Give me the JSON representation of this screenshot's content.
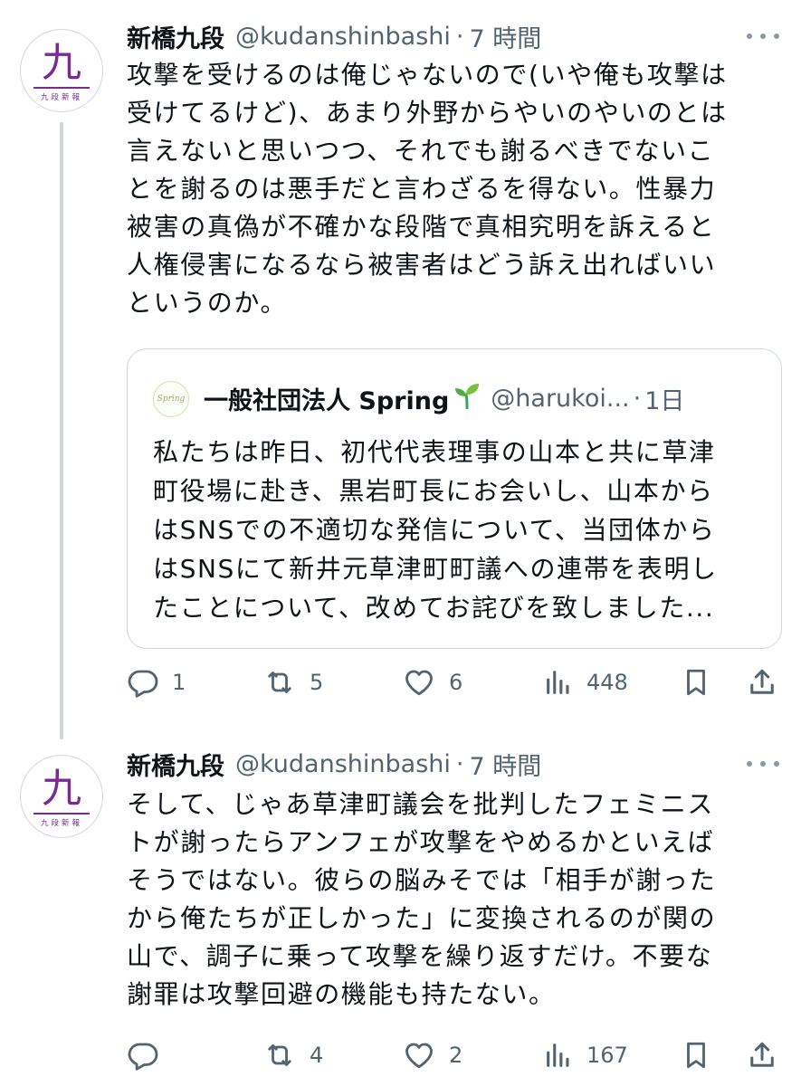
{
  "tweets": [
    {
      "author": "新橋九段",
      "handle": "@kudanshinbashi",
      "separator": "·",
      "time": "7 時間",
      "avatar": {
        "kanji": "九",
        "subtitle": "九段新報",
        "icon": "kudan-shinpo-logo"
      },
      "text": "攻撃を受けるのは俺じゃないので(いや俺も攻撃は\n受けてるけど)、あまり外野からやいのやいのとは\n言えないと思いつつ、それでも謝るべきでないこ\nとを謝るのは悪手だと言わざるを得ない。性暴力\n被害の真偽が不確かな段階で真相究明を訴えると\n人権侵害になるなら被害者はどう訴え出ればいい\nというのか。",
      "quote": {
        "author": "一般社団法人 Spring",
        "author_emoji": "seedling-icon",
        "handle": "@harukoi...",
        "separator": "·",
        "time": "1日",
        "avatar_text": "Spring",
        "text": "私たちは昨日、初代代表理事の山本と共に草津\n町役場に赴き、黒岩町長にお会いし、山本から\nはSNSでの不適切な発信について、当団体から\nはSNSにて新井元草津町町議への連帯を表明し\nたことについて、改めてお詫びを致しました..."
      },
      "stats": {
        "replies": "1",
        "reposts": "5",
        "likes": "6",
        "views": "448"
      }
    },
    {
      "author": "新橋九段",
      "handle": "@kudanshinbashi",
      "separator": "·",
      "time": "7 時間",
      "avatar": {
        "kanji": "九",
        "subtitle": "九段新報",
        "icon": "kudan-shinpo-logo"
      },
      "text": "そして、じゃあ草津町議会を批判したフェミニス\nトが謝ったらアンフェが攻撃をやめるかといえば\nそうではない。彼らの脳みそでは「相手が謝った\nから俺たちが正しかった」に変換されるのが関の\n山で、調子に乗って攻撃を繰り返すだけ。不要な\n謝罪は攻撃回避の機能も持たない。",
      "stats": {
        "replies": "",
        "reposts": "4",
        "likes": "2",
        "views": "167"
      }
    }
  ],
  "icons": {
    "reply": "reply-icon",
    "repost": "repost-icon",
    "like": "like-icon",
    "views": "views-icon",
    "bookmark": "bookmark-icon",
    "share": "share-icon",
    "more": "more-icon"
  },
  "colors": {
    "text": "#0f1419",
    "muted": "#536471",
    "border": "#cfd9de",
    "avatar_accent": "#7a2a92",
    "sprout": "#3ba55c"
  }
}
